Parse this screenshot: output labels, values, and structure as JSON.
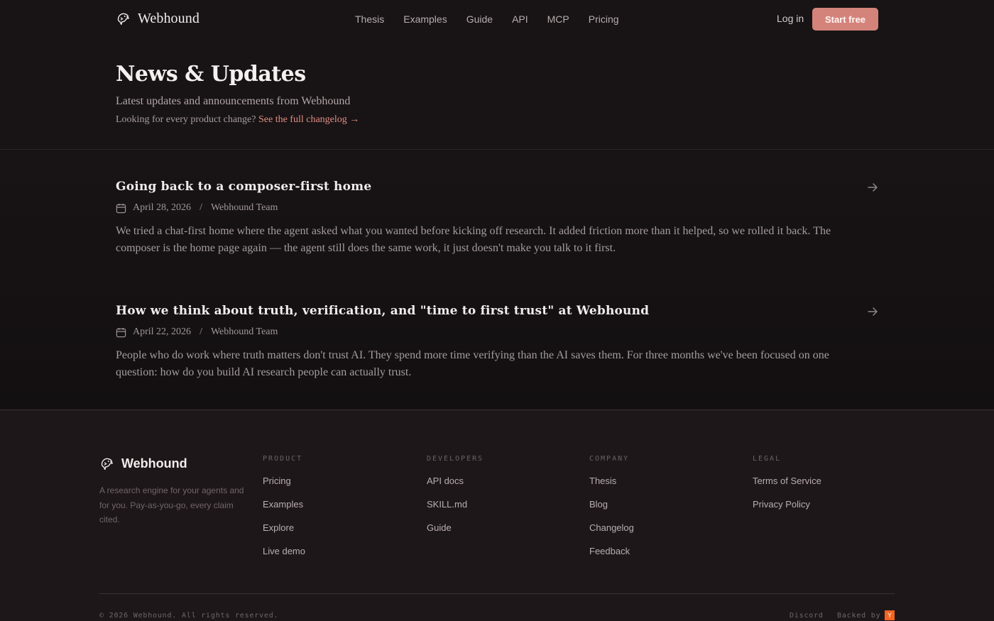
{
  "brand": {
    "name": "Webhound"
  },
  "nav": {
    "links": [
      "Thesis",
      "Examples",
      "Guide",
      "API",
      "MCP",
      "Pricing"
    ],
    "login": "Log in",
    "cta": "Start free"
  },
  "hero": {
    "title": "News & Updates",
    "subtitle": "Latest updates and announcements from Webhound",
    "note_prefix": "Looking for every product change?",
    "note_link": "See the full changelog →"
  },
  "posts": [
    {
      "title": "Going back to a composer-first home",
      "date": "April 28, 2026",
      "author": "Webhound Team",
      "excerpt": "We tried a chat-first home where the agent asked what you wanted before kicking off research. It added friction more than it helped, so we rolled it back. The composer is the home page again — the agent still does the same work, it just doesn't make you talk to it first."
    },
    {
      "title": "How we think about truth, verification, and \"time to first trust\" at Webhound",
      "date": "April 22, 2026",
      "author": "Webhound Team",
      "excerpt": "People who do work where truth matters don't trust AI. They spend more time verifying than the AI saves them. For three months we've been focused on one question: how do you build AI research people can actually trust."
    }
  ],
  "footer": {
    "brand": "Webhound",
    "tagline": "A research engine for your agents and for you. Pay-as-you-go, every claim cited.",
    "columns": [
      {
        "heading": "PRODUCT",
        "links": [
          "Pricing",
          "Examples",
          "Explore",
          "Live demo"
        ]
      },
      {
        "heading": "DEVELOPERS",
        "links": [
          "API docs",
          "SKILL.md",
          "Guide"
        ]
      },
      {
        "heading": "COMPANY",
        "links": [
          "Thesis",
          "Blog",
          "Changelog",
          "Feedback"
        ]
      },
      {
        "heading": "LEGAL",
        "links": [
          "Terms of Service",
          "Privacy Policy"
        ]
      }
    ],
    "copyright": "© 2026 Webhound. All rights reserved.",
    "discord": "Discord",
    "backed_by": "Backed by",
    "backer_mark": "Y"
  },
  "colors": {
    "accent": "#d4837b",
    "link": "#e08f83",
    "background": "#181315",
    "yc": "#f26522"
  }
}
